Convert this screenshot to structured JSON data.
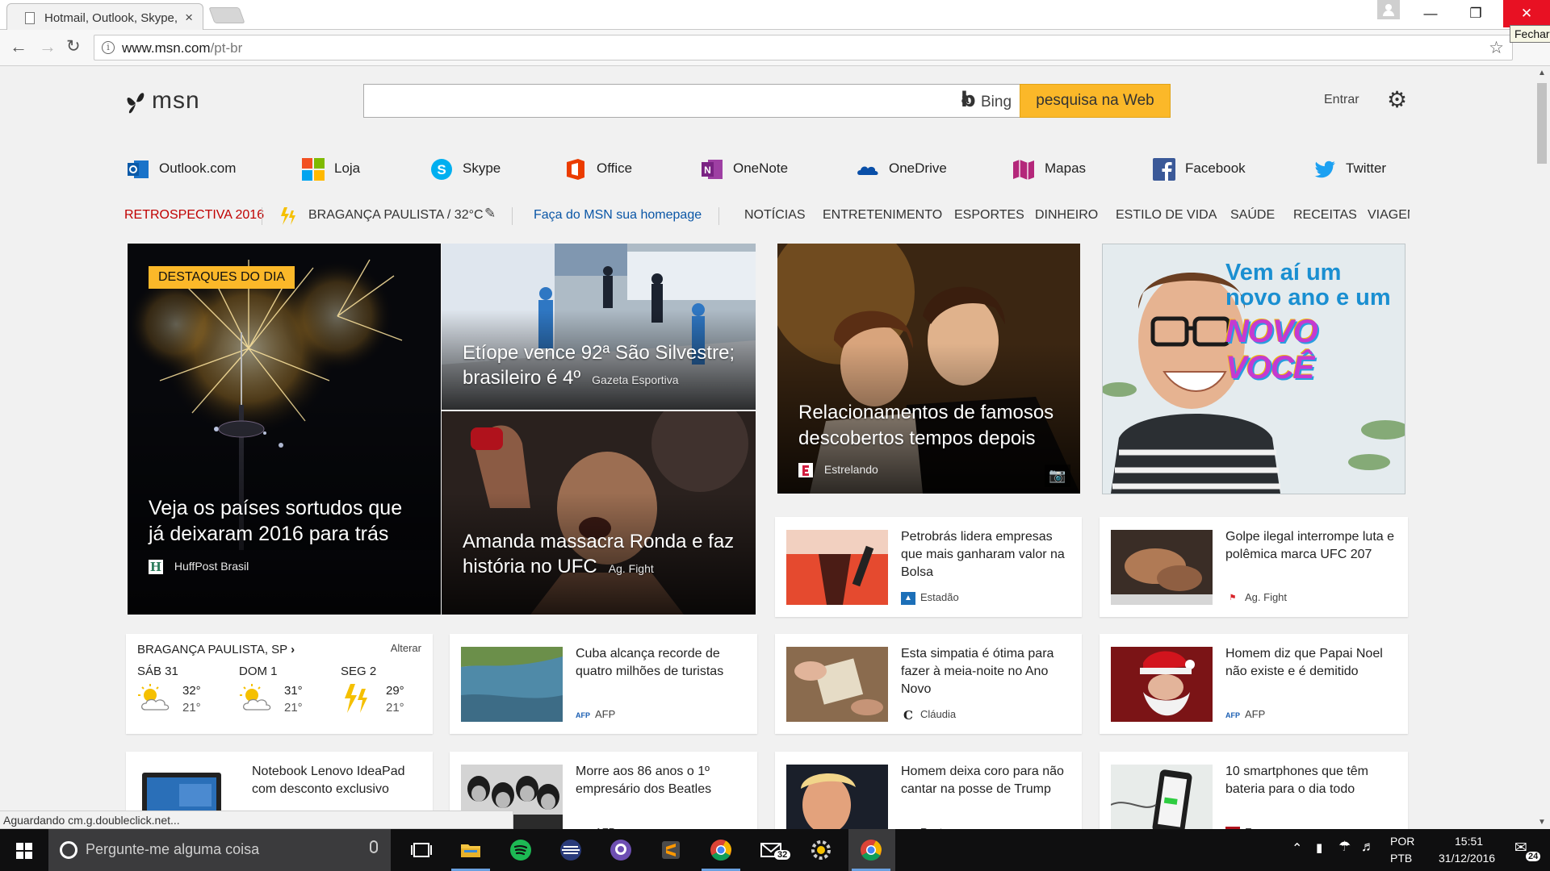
{
  "browser": {
    "tab_title": "Hotmail, Outlook, Skype,",
    "tab_close": "×",
    "url_host": "www.msn.com",
    "url_path": "/pt-br",
    "tooltip": "Fechar",
    "status": "Aguardando cm.g.doubleclick.net..."
  },
  "header": {
    "logo": "msn",
    "bing_label": "Bing",
    "search_button": "pesquisa na Web",
    "signin": "Entrar"
  },
  "quicklinks": [
    {
      "label": "Outlook.com",
      "icon": "outlook-icon"
    },
    {
      "label": "Loja",
      "icon": "store-icon"
    },
    {
      "label": "Skype",
      "icon": "skype-icon"
    },
    {
      "label": "Office",
      "icon": "office-icon"
    },
    {
      "label": "OneNote",
      "icon": "onenote-icon"
    },
    {
      "label": "OneDrive",
      "icon": "onedrive-icon"
    },
    {
      "label": "Mapas",
      "icon": "maps-icon"
    },
    {
      "label": "Facebook",
      "icon": "facebook-icon"
    },
    {
      "label": "Twitter",
      "icon": "twitter-icon"
    }
  ],
  "nav": {
    "retro": "RETROSPECTIVA 2016",
    "weather_loc": "BRAGANÇA PAULISTA / 32°C",
    "homepage": "Faça do MSN sua homepage",
    "sections": [
      "NOTÍCIAS",
      "ENTRETENIMENTO",
      "ESPORTES",
      "DINHEIRO",
      "ESTILO DE VIDA",
      "SAÚDE",
      "RECEITAS",
      "VIAGEM"
    ]
  },
  "hero": {
    "badge": "DESTAQUES DO DIA",
    "main": {
      "title": "Veja os países sortudos que já deixaram 2016 para trás",
      "source": "HuffPost Brasil"
    },
    "top_right": {
      "title": "Etíope vence 92ª São Silvestre; brasileiro é 4º",
      "source": "Gazeta Esportiva"
    },
    "bottom_right": {
      "title": "Amanda massacra Ronda e faz história no UFC",
      "source": "Ag. Fight"
    }
  },
  "feature": {
    "title": "Relacionamentos de famosos descobertos tempos depois",
    "source": "Estrelando"
  },
  "ad": {
    "line1": "Vem aí um",
    "line2": "novo ano e um",
    "line3": "NOVO VOCÊ"
  },
  "weather": {
    "city": "BRAGANÇA PAULISTA, SP",
    "change": "Alterar",
    "days": [
      {
        "day": "SÁB 31",
        "hi": "32°",
        "lo": "21°",
        "icon": "partly-sunny-icon"
      },
      {
        "day": "DOM 1",
        "hi": "31°",
        "lo": "21°",
        "icon": "partly-sunny-icon"
      },
      {
        "day": "SEG 2",
        "hi": "29°",
        "lo": "21°",
        "icon": "thunderstorm-icon"
      }
    ]
  },
  "cards": [
    {
      "title": "Petrobrás lidera empresas que mais ganharam valor na Bolsa",
      "source": "Estadão"
    },
    {
      "title": "Golpe ilegal interrompe luta e polêmica marca UFC 207",
      "source": "Ag. Fight"
    },
    {
      "title": "Cuba alcança recorde de quatro milhões de turistas",
      "source": "AFP"
    },
    {
      "title": "Esta simpatia é ótima para fazer à meia-noite no Ano Novo",
      "source": "Cláudia"
    },
    {
      "title": "Homem diz que Papai Noel não existe e é demitido",
      "source": "AFP"
    },
    {
      "title": "Notebook Lenovo IdeaPad com desconto exclusivo",
      "source": ""
    },
    {
      "title": "Morre aos 86 anos o 1º empresário dos Beatles",
      "source": "AFP"
    },
    {
      "title": "Homem deixa coro para não cantar na posse de Trump",
      "source": "Reuters"
    },
    {
      "title": "10 smartphones que têm bateria para o dia todo",
      "source": "Exame.com"
    }
  ],
  "taskbar": {
    "search_placeholder": "Pergunte-me alguma coisa",
    "mail_count": "32",
    "lang1": "POR",
    "lang2": "PTB",
    "time": "15:51",
    "date": "31/12/2016",
    "notif_count": "24"
  },
  "colors": {
    "accent_yellow": "#fbb829",
    "retro_red": "#c00000",
    "link_blue": "#0a56a6",
    "close_red": "#e81123"
  }
}
